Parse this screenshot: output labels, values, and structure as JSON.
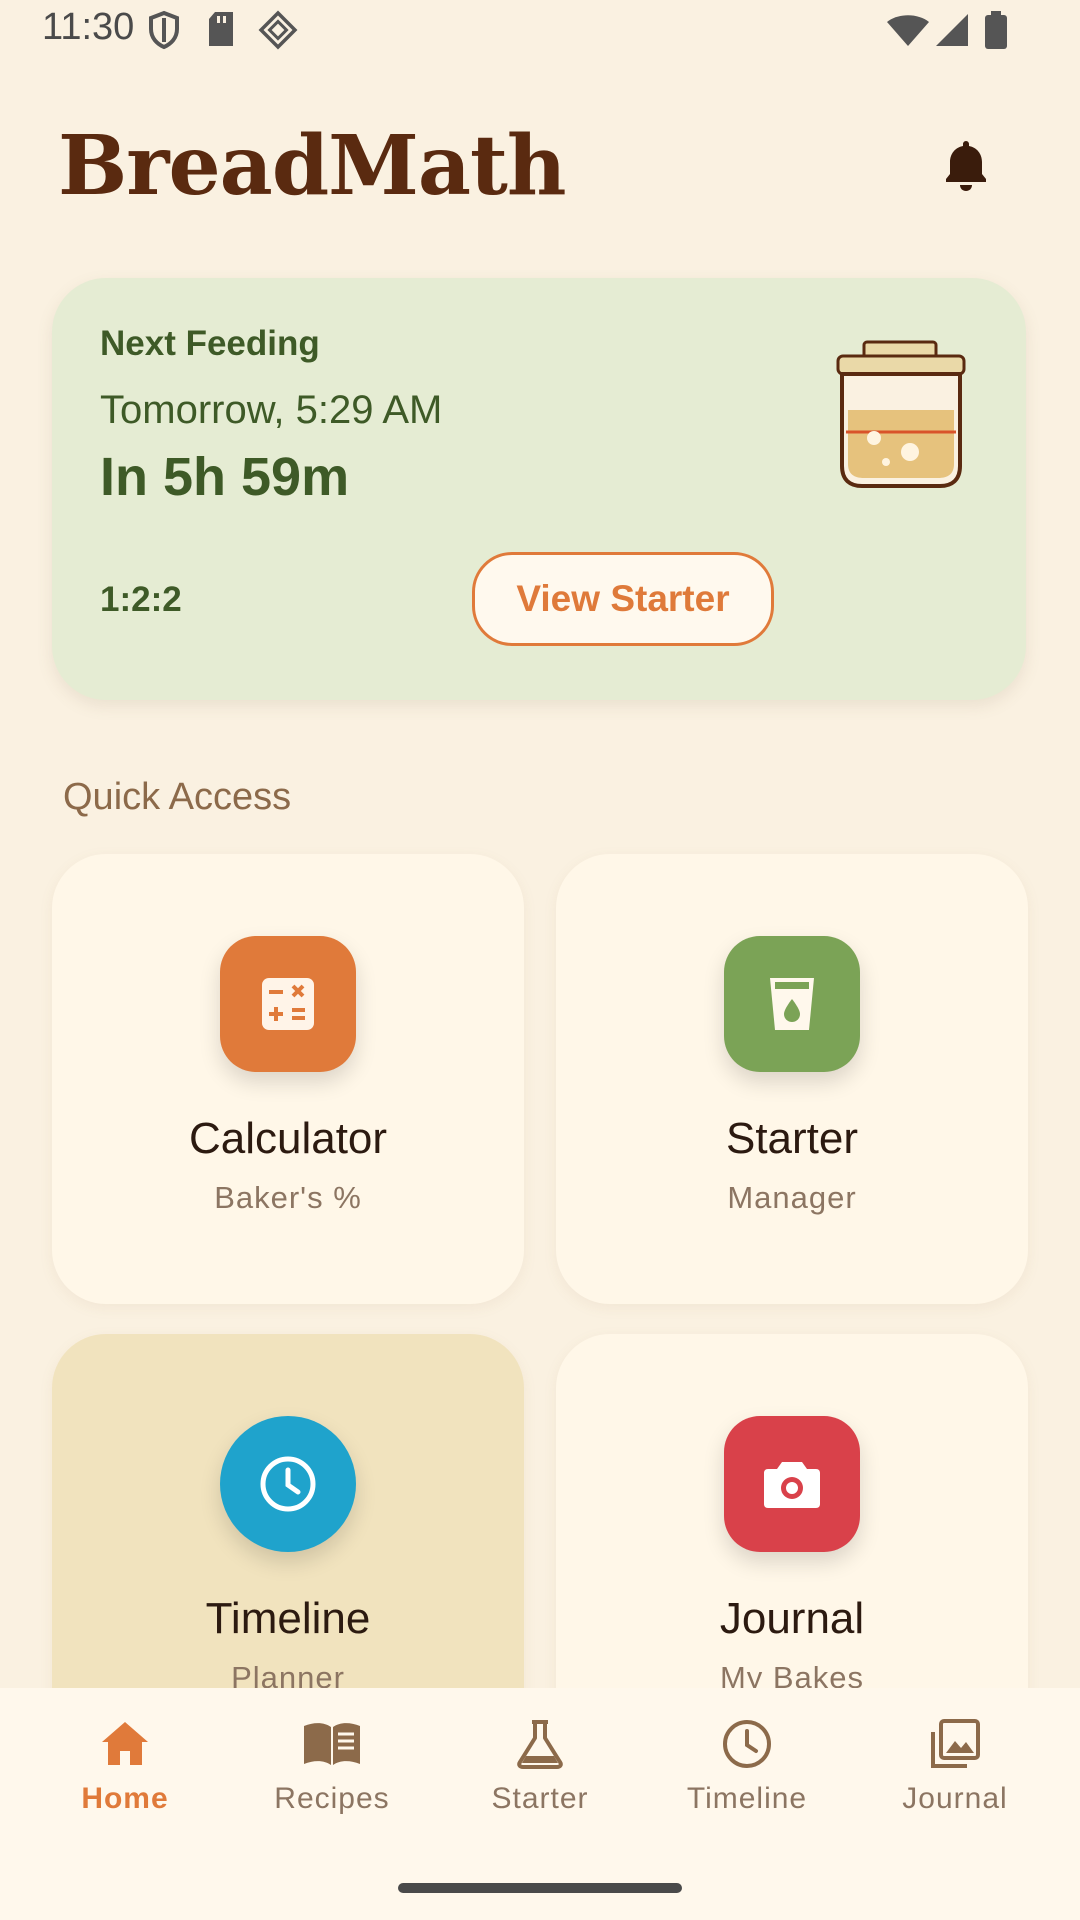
{
  "status_bar": {
    "time": "11:30"
  },
  "header": {
    "title": "BreadMath"
  },
  "feeding_card": {
    "label": "Next Feeding",
    "time": "Tomorrow, 5:29 AM",
    "countdown": "In 5h 59m",
    "ratio": "1:2:2",
    "button_label": "View Starter"
  },
  "quick_access": {
    "title": "Quick Access",
    "tiles": [
      {
        "title": "Calculator",
        "subtitle": "Baker's %",
        "icon": "calculator-icon",
        "color": "#E07A3A"
      },
      {
        "title": "Starter",
        "subtitle": "Manager",
        "icon": "starter-jar-icon",
        "color": "#7BA356"
      },
      {
        "title": "Timeline",
        "subtitle": "Planner",
        "icon": "clock-icon",
        "color": "#1FA3CC"
      },
      {
        "title": "Journal",
        "subtitle": "My Bakes",
        "icon": "camera-icon",
        "color": "#D9414A"
      }
    ]
  },
  "bottom_nav": {
    "active": "Home",
    "items": [
      {
        "label": "Home",
        "icon": "home-icon"
      },
      {
        "label": "Recipes",
        "icon": "book-icon"
      },
      {
        "label": "Starter",
        "icon": "flask-icon"
      },
      {
        "label": "Timeline",
        "icon": "clock-icon"
      },
      {
        "label": "Journal",
        "icon": "gallery-icon"
      }
    ]
  },
  "colors": {
    "background": "#FAF1E1",
    "accent": "#E07A3A",
    "card_green": "#E5ECD3",
    "title_brown": "#5A2A10"
  }
}
